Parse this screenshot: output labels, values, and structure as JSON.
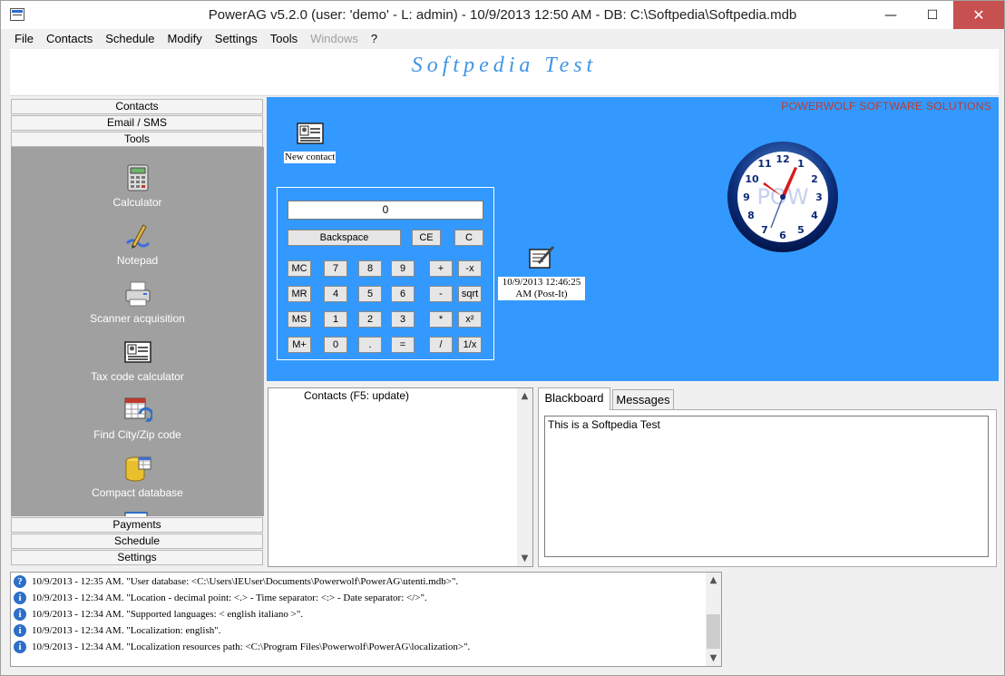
{
  "window": {
    "title": "PowerAG v5.2.0  (user: 'demo'  - L: admin) - 10/9/2013 12:50 AM - DB: C:\\Softpedia\\Softpedia.mdb",
    "minimize_glyph": "—",
    "maximize_glyph": "☐",
    "close_glyph": "✕"
  },
  "menu": {
    "items": [
      {
        "label": "File",
        "enabled": true
      },
      {
        "label": "Contacts",
        "enabled": true
      },
      {
        "label": "Schedule",
        "enabled": true
      },
      {
        "label": "Modify",
        "enabled": true
      },
      {
        "label": "Settings",
        "enabled": true
      },
      {
        "label": "Tools",
        "enabled": true
      },
      {
        "label": "Windows",
        "enabled": false
      },
      {
        "label": "?",
        "enabled": true
      }
    ]
  },
  "banner": {
    "text": "Softpedia Test"
  },
  "sidebar": {
    "headers_top": [
      "Contacts",
      "Email / SMS",
      "Tools"
    ],
    "tools": [
      {
        "label": "Calculator",
        "icon": "calculator-icon"
      },
      {
        "label": "Notepad",
        "icon": "notepad-icon"
      },
      {
        "label": "Scanner acquisition",
        "icon": "scanner-icon"
      },
      {
        "label": "Tax code calculator",
        "icon": "id-card-icon"
      },
      {
        "label": "Find City/Zip code",
        "icon": "city-zip-icon"
      },
      {
        "label": "Compact database",
        "icon": "database-icon"
      }
    ],
    "headers_bottom": [
      "Payments",
      "Schedule",
      "Settings"
    ],
    "scroll_glyph": "▼"
  },
  "desktop": {
    "company": "POWERWOLF SOFTWARE SOLUTIONS",
    "new_contact_label": "New contact",
    "postit_label_line1": "10/9/2013 12:46:25",
    "postit_label_line2": "AM (Post-It)",
    "calculator": {
      "display": "0",
      "top_buttons": [
        "Backspace",
        "CE",
        "C"
      ],
      "rows": [
        [
          "MC",
          "7",
          "8",
          "9",
          "+",
          "-x"
        ],
        [
          "MR",
          "4",
          "5",
          "6",
          "-",
          "sqrt"
        ],
        [
          "MS",
          "1",
          "2",
          "3",
          "*",
          "x²"
        ],
        [
          "M+",
          "0",
          ".",
          "=",
          "/",
          "1/x"
        ]
      ]
    },
    "clock": {
      "numbers": [
        "12",
        "1",
        "2",
        "3",
        "4",
        "5",
        "6",
        "7",
        "8",
        "9",
        "10",
        "11"
      ],
      "logo": "POW"
    }
  },
  "contacts_pane": {
    "title": "Contacts  (F5: update)",
    "up_glyph": "▲",
    "down_glyph": "▼"
  },
  "board": {
    "tabs": [
      "Blackboard",
      "Messages"
    ],
    "text": "This is a Softpedia Test"
  },
  "log": {
    "icon_glyph": "i",
    "scroll_up": "▲",
    "scroll_down": "▼",
    "entries": [
      "10/9/2013 - 12:35 AM. \"User database: <C:\\Users\\IEUser\\Documents\\Powerwolf\\PowerAG\\utenti.mdb>\".",
      "10/9/2013 - 12:34 AM. \"Location - decimal point: <.> - Time separator: <:> - Date separator: </>\".",
      "10/9/2013 - 12:34 AM. \"Supported languages: < english italiano >\".",
      "10/9/2013 - 12:34 AM. \"Localization: english\".",
      "10/9/2013 - 12:34 AM. \"Localization resources path: <C:\\Program Files\\Powerwolf\\PowerAG\\localization>\"."
    ]
  },
  "colors": {
    "desktop_bg": "#3399ff",
    "banner_text": "#3f95e6",
    "company_text": "#c0392b",
    "tools_bg": "#a0a0a0",
    "close_button": "#c75050"
  }
}
